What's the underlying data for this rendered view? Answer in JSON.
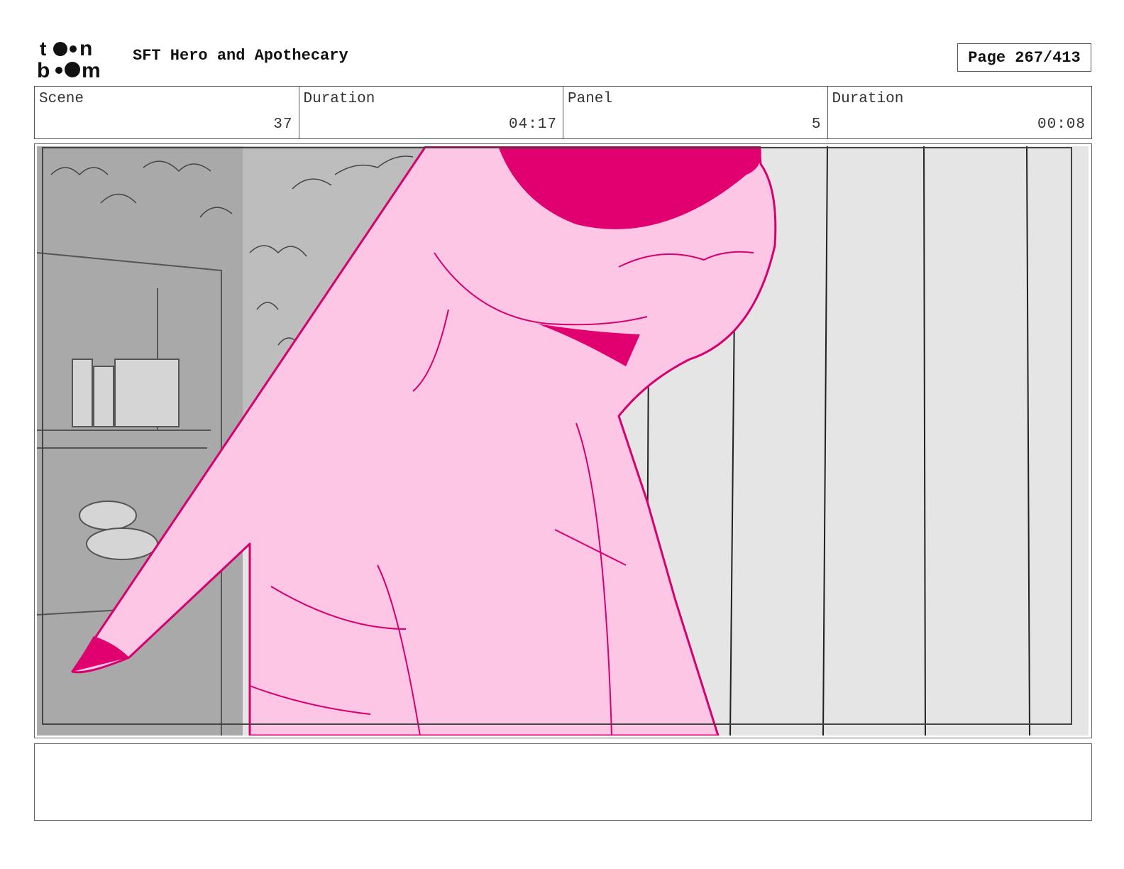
{
  "header": {
    "logo_text_top": "toon",
    "logo_text_bottom": "boom",
    "project_title": "SFT Hero and Apothecary",
    "page_label": "Page 267/413"
  },
  "info": {
    "scene_label": "Scene",
    "scene_value": "37",
    "scene_duration_label": "Duration",
    "scene_duration_value": "04:17",
    "panel_label": "Panel",
    "panel_value": "5",
    "panel_duration_label": "Duration",
    "panel_duration_value": "00:08"
  },
  "colors": {
    "character_fill": "#fcc6e4",
    "character_line": "#d6006e",
    "character_shadow": "#e0006f",
    "background_grey": "#bdbdbd",
    "wall_grey": "#e5e5e5"
  },
  "notes": {
    "text": ""
  }
}
